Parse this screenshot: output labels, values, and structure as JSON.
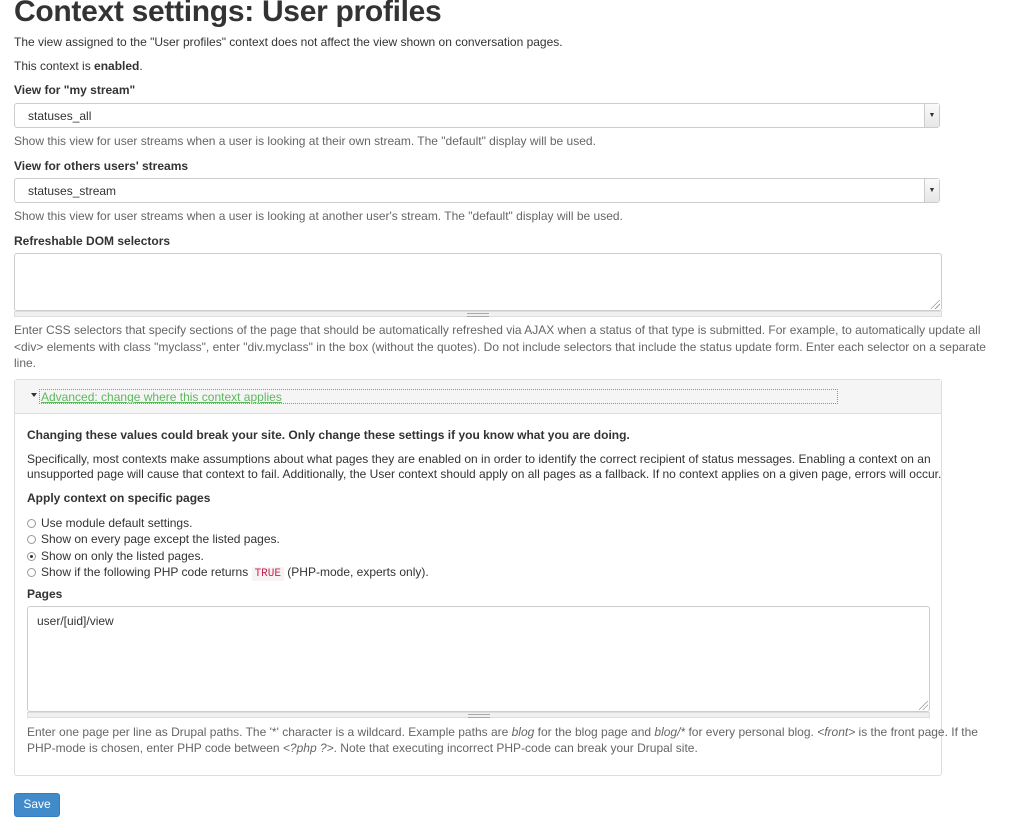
{
  "page": {
    "title": "Context settings: User profiles",
    "intro": "The view assigned to the \"User profiles\" context does not affect the view shown on conversation pages.",
    "status_prefix": "This context is ",
    "status_value": "enabled",
    "status_suffix": "."
  },
  "my_stream": {
    "label": "View for \"my stream\"",
    "value": "statuses_all",
    "help": "Show this view for user streams when a user is looking at their own stream. The \"default\" display will be used."
  },
  "others_stream": {
    "label": "View for others users' streams",
    "value": "statuses_stream",
    "help": "Show this view for user streams when a user is looking at another user's stream. The \"default\" display will be used."
  },
  "selectors": {
    "label": "Refreshable DOM selectors",
    "value": "",
    "help_line1": "Enter CSS selectors that specify sections of the page that should be automatically refreshed via AJAX when a status of that type is submitted. For example, to automatically update all",
    "help_line2": "<div> elements with class \"myclass\", enter \"div.myclass\" in the box (without the quotes). Do not include selectors that include the status update form. Enter each selector on a separate",
    "help_line3": "line."
  },
  "advanced": {
    "legend": "Advanced: change where this context applies",
    "warning": "Changing these values could break your site. Only change these settings if you know what you are doing.",
    "desc_line1": "Specifically, most contexts make assumptions about what pages they are enabled on in order to identify the correct recipient of status messages. Enabling a context on an",
    "desc_line2": "unsupported page will cause that context to fail. Additionally, the User context should apply on all pages as a fallback. If no context applies on a given page, errors will occur.",
    "apply_label": "Apply context on specific pages",
    "options": [
      {
        "label": "Use module default settings.",
        "checked": false
      },
      {
        "label": "Show on every page except the listed pages.",
        "checked": false
      },
      {
        "label": "Show on only the listed pages.",
        "checked": true
      },
      {
        "label_before": "Show if the following PHP code returns ",
        "code": "TRUE",
        "label_after": " (PHP-mode, experts only).",
        "checked": false
      }
    ],
    "pages_label": "Pages",
    "pages_value": "user/[uid]/view",
    "pages_help_line1": "Enter one page per line as Drupal paths. The '*' character is a wildcard. Example paths are ",
    "pages_help_blog": "blog",
    "pages_help_mid1": " for the blog page and ",
    "pages_help_blogstar": "blog/*",
    "pages_help_mid2": " for every personal blog. ",
    "pages_help_front": "<front>",
    "pages_help_end1": " is the front page. If the",
    "pages_help_line2a": "PHP-mode is chosen, enter PHP code between ",
    "pages_help_php": "<?php ?>",
    "pages_help_line2b": ". Note that executing incorrect PHP-code can break your Drupal site."
  },
  "actions": {
    "save_label": "Save"
  }
}
